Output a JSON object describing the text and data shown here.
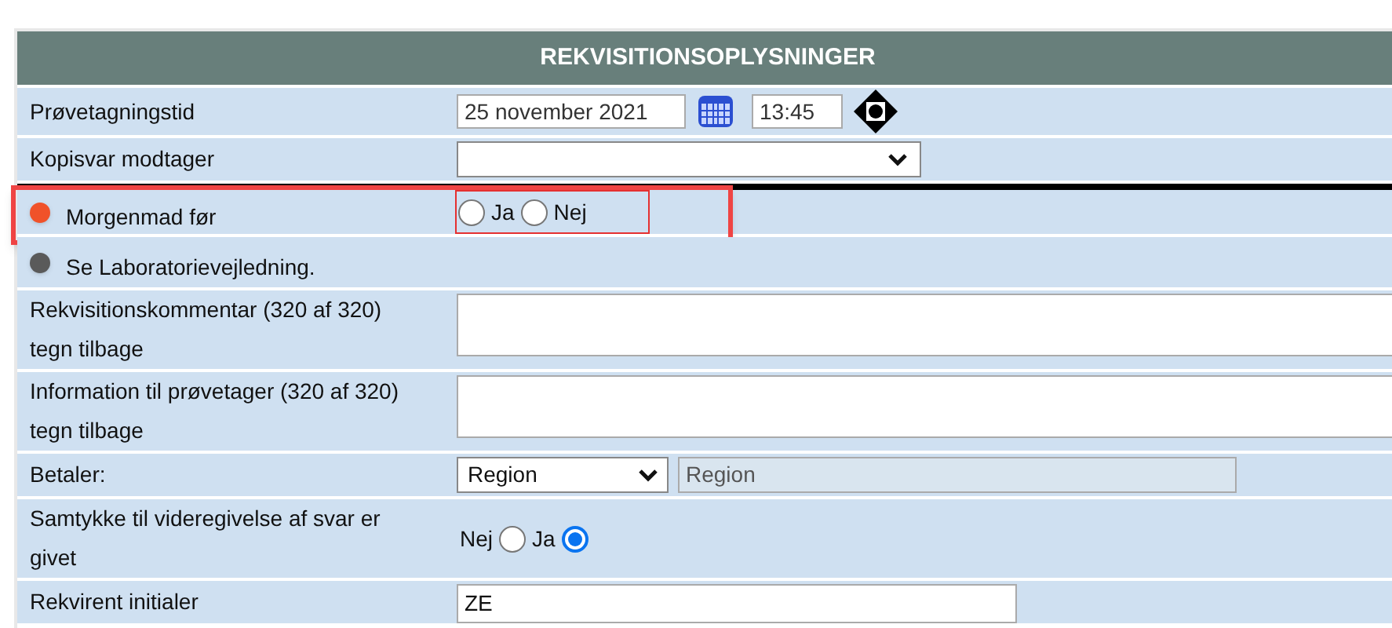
{
  "panel": {
    "title": "REKVISITIONSOPLYSNINGER"
  },
  "rows": [
    {
      "kind": "datetime",
      "label": "Prøvetagningstid",
      "date": "25 november 2021",
      "time": "13:45"
    },
    {
      "kind": "select",
      "label": "Kopisvar modtager"
    },
    {
      "kind": "radio",
      "label": "Morgenmad før",
      "color": "#f0522a",
      "separator_before": true,
      "highlighted": true,
      "label_first": false,
      "options": [
        {
          "label": "Ja",
          "selected": false
        },
        {
          "label": "Nej",
          "selected": false
        }
      ]
    },
    {
      "kind": "note",
      "label": "Se Laboratorievejledning.",
      "color": "#5a5a5a"
    },
    {
      "kind": "textarea",
      "label": "Rekvisitionskommentar (320 af 320) tegn tilbage"
    },
    {
      "kind": "textarea",
      "label": "Information til prøvetager (320 af 320) tegn tilbage"
    },
    {
      "kind": "select_readonly",
      "label": "Betaler:",
      "value": "Region",
      "readonly": "Region"
    },
    {
      "kind": "radio",
      "label": "Samtykke til videregivelse af svar er givet",
      "label_first": true,
      "options": [
        {
          "label": "Nej",
          "selected": false
        },
        {
          "label": "Ja",
          "selected": true
        }
      ]
    },
    {
      "kind": "text",
      "label": "Rekvirent initialer",
      "value": "ZE"
    }
  ]
}
